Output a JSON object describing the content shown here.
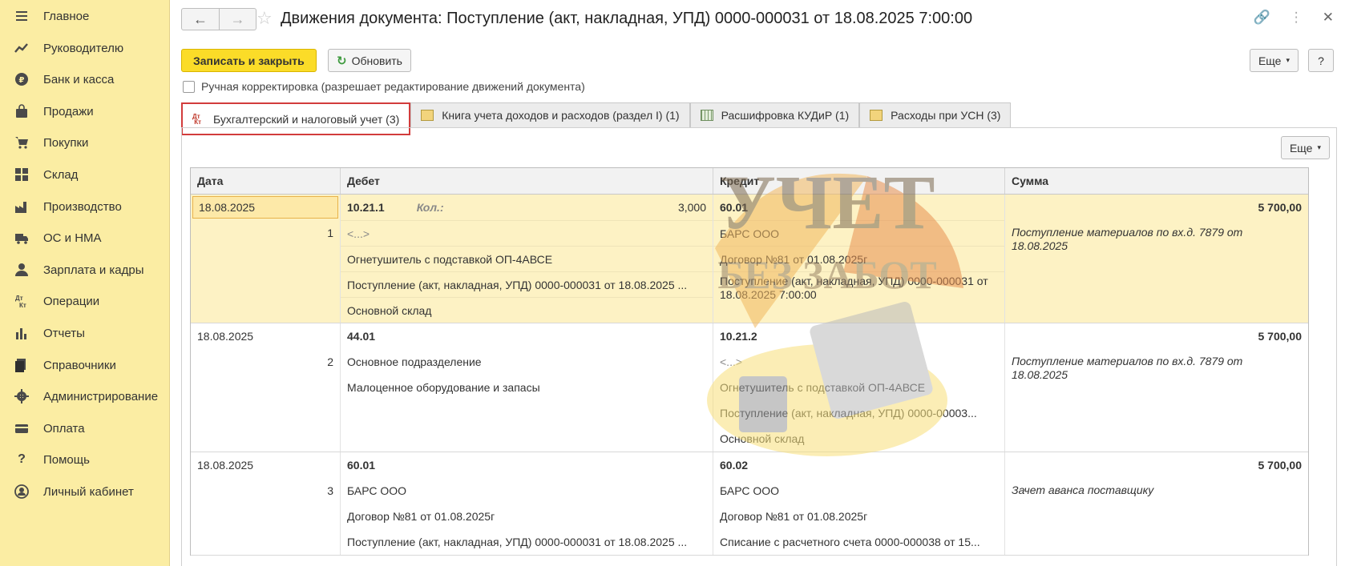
{
  "sidebar": {
    "items": [
      {
        "label": "Главное",
        "icon": "menu-icon"
      },
      {
        "label": "Руководителю",
        "icon": "trend-icon"
      },
      {
        "label": "Банк и касса",
        "icon": "coin-icon"
      },
      {
        "label": "Продажи",
        "icon": "bag-icon"
      },
      {
        "label": "Покупки",
        "icon": "cart-icon"
      },
      {
        "label": "Склад",
        "icon": "warehouse-icon"
      },
      {
        "label": "Производство",
        "icon": "factory-icon"
      },
      {
        "label": "ОС и НМА",
        "icon": "truck-icon"
      },
      {
        "label": "Зарплата и кадры",
        "icon": "person-icon"
      },
      {
        "label": "Операции",
        "icon": "dtkt-icon"
      },
      {
        "label": "Отчеты",
        "icon": "bar-chart-icon"
      },
      {
        "label": "Справочники",
        "icon": "books-icon"
      },
      {
        "label": "Администрирование",
        "icon": "gear-icon"
      },
      {
        "label": "Оплата",
        "icon": "card-icon"
      },
      {
        "label": "Помощь",
        "icon": "question-icon"
      },
      {
        "label": "Личный кабинет",
        "icon": "account-icon"
      }
    ]
  },
  "header": {
    "back": "←",
    "forward": "→",
    "title": "Движения документа: Поступление (акт, накладная, УПД) 0000-000031 от 18.08.2025 7:00:00",
    "icons": {
      "link": "🔗",
      "more": "⋮",
      "close": "✕"
    }
  },
  "toolbar": {
    "save_label": "Записать и закрыть",
    "refresh_label": "Обновить",
    "more_label": "Еще",
    "help_label": "?"
  },
  "manual": {
    "label": "Ручная корректировка (разрешает редактирование движений документа)",
    "checked": false
  },
  "tabs": [
    {
      "label": "Бухгалтерский и налоговый учет (3)",
      "active": true
    },
    {
      "label": "Книга учета доходов и расходов (раздел I) (1)",
      "active": false
    },
    {
      "label": "Расшифровка КУДиР (1)",
      "active": false
    },
    {
      "label": "Расходы при УСН (3)",
      "active": false
    }
  ],
  "panel": {
    "more_label": "Еще"
  },
  "table": {
    "columns": [
      "Дата",
      "Дебет",
      "Кредит",
      "Сумма"
    ],
    "rows": [
      {
        "date": "18.08.2025",
        "num": "1",
        "debit_account": "10.21.1",
        "debit_kol_label": "Кол.:",
        "debit_qty": "3,000",
        "debit_lines": [
          "<...>",
          "Огнетушитель с подставкой ОП-4АВСЕ",
          "Поступление (акт, накладная, УПД) 0000-000031 от 18.08.2025 ...",
          "Основной склад"
        ],
        "credit_account": "60.01",
        "credit_lines": [
          "БАРС ООО",
          "Договор №81 от 01.08.2025г",
          "Поступление (акт, накладная, УПД) 0000-000031 от 18.08.2025 7:00:00"
        ],
        "sum": "5 700,00",
        "comment": "Поступление материалов по вх.д. 7879 от 18.08.2025"
      },
      {
        "date": "18.08.2025",
        "num": "2",
        "debit_account": "44.01",
        "debit_lines": [
          "Основное подразделение",
          "Малоценное оборудование и запасы"
        ],
        "credit_account": "10.21.2",
        "credit_lines": [
          "<...>",
          "Огнетушитель с подставкой ОП-4АВСЕ",
          "Поступление (акт, накладная, УПД) 0000-00003...",
          "Основной склад"
        ],
        "sum": "5 700,00",
        "comment": "Поступление материалов по вх.д. 7879 от 18.08.2025"
      },
      {
        "date": "18.08.2025",
        "num": "3",
        "debit_account": "60.01",
        "debit_lines": [
          "БАРС ООО",
          "Договор №81 от 01.08.2025г",
          "Поступление (акт, накладная, УПД) 0000-000031 от 18.08.2025 ..."
        ],
        "credit_account": "60.02",
        "credit_lines": [
          "БАРС ООО",
          "Договор №81 от 01.08.2025г",
          "Списание с расчетного счета 0000-000038 от 15..."
        ],
        "sum": "5 700,00",
        "comment": "Зачет аванса поставщику"
      }
    ]
  },
  "watermark": {
    "line1": "УЧЕТ",
    "line2": "БЕЗ ЗАБОТ"
  }
}
